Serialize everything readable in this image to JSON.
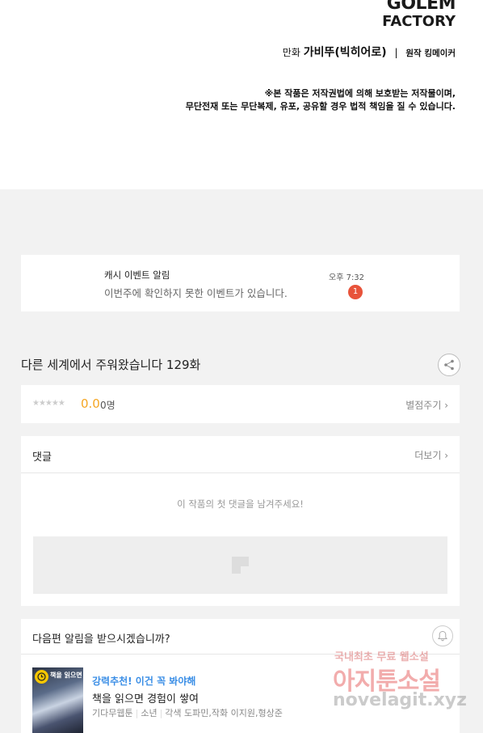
{
  "header": {
    "logo_line1": "GOLEM",
    "logo_line2": "FACTORY",
    "credits_prefix": "만화",
    "credits_artist": "가비뚜(빅히어로)",
    "credits_separator": "|",
    "credits_original": "원작 킹메이커",
    "notice_line1": "※본 작품은 저작권법에 의해 보호받는 저작물이며,",
    "notice_line2": "무단전재 또는 무단복제, 유포, 공유할 경우 법적 책임을 질 수 있습니다."
  },
  "alarm": {
    "title": "캐시 이벤트 알림",
    "message": "이번주에 확인하지 못한 이벤트가 있습니다.",
    "time": "오후 7:32",
    "badge": "1"
  },
  "episode": {
    "title": "다른 세계에서 주워왔습니다 129화",
    "share_icon": "share-icon"
  },
  "rating": {
    "stars": "★★★★★",
    "score": "0.0",
    "count": "0명",
    "rate_label": "별점주기 ›"
  },
  "comments": {
    "label": "댓글",
    "more_label": "더보기 ›",
    "empty_text": "이 작품의 첫 댓글을 남겨주세요!"
  },
  "next": {
    "question": "다음편 알림을 받으시겠습니까?",
    "bell_icon": "bell-icon"
  },
  "recommend": {
    "thumb_text": "책을 읽으면",
    "tag": "강력추천! 이건 꼭 봐야해",
    "title": "책을 읽으면 경험이 쌓여",
    "meta_platform": "기다무웹툰",
    "meta_genre": "소년",
    "meta_credits": "각색 도파민,작화 이지원,형상준"
  },
  "watermark": {
    "line1": "국내최초 무료 웹소설",
    "line2": "아지툰소설",
    "line3": "novelagit.xyz"
  },
  "colors": {
    "accent_orange": "#f5a623",
    "badge_red": "#e8533a",
    "tag_blue": "#3a8ee6"
  }
}
